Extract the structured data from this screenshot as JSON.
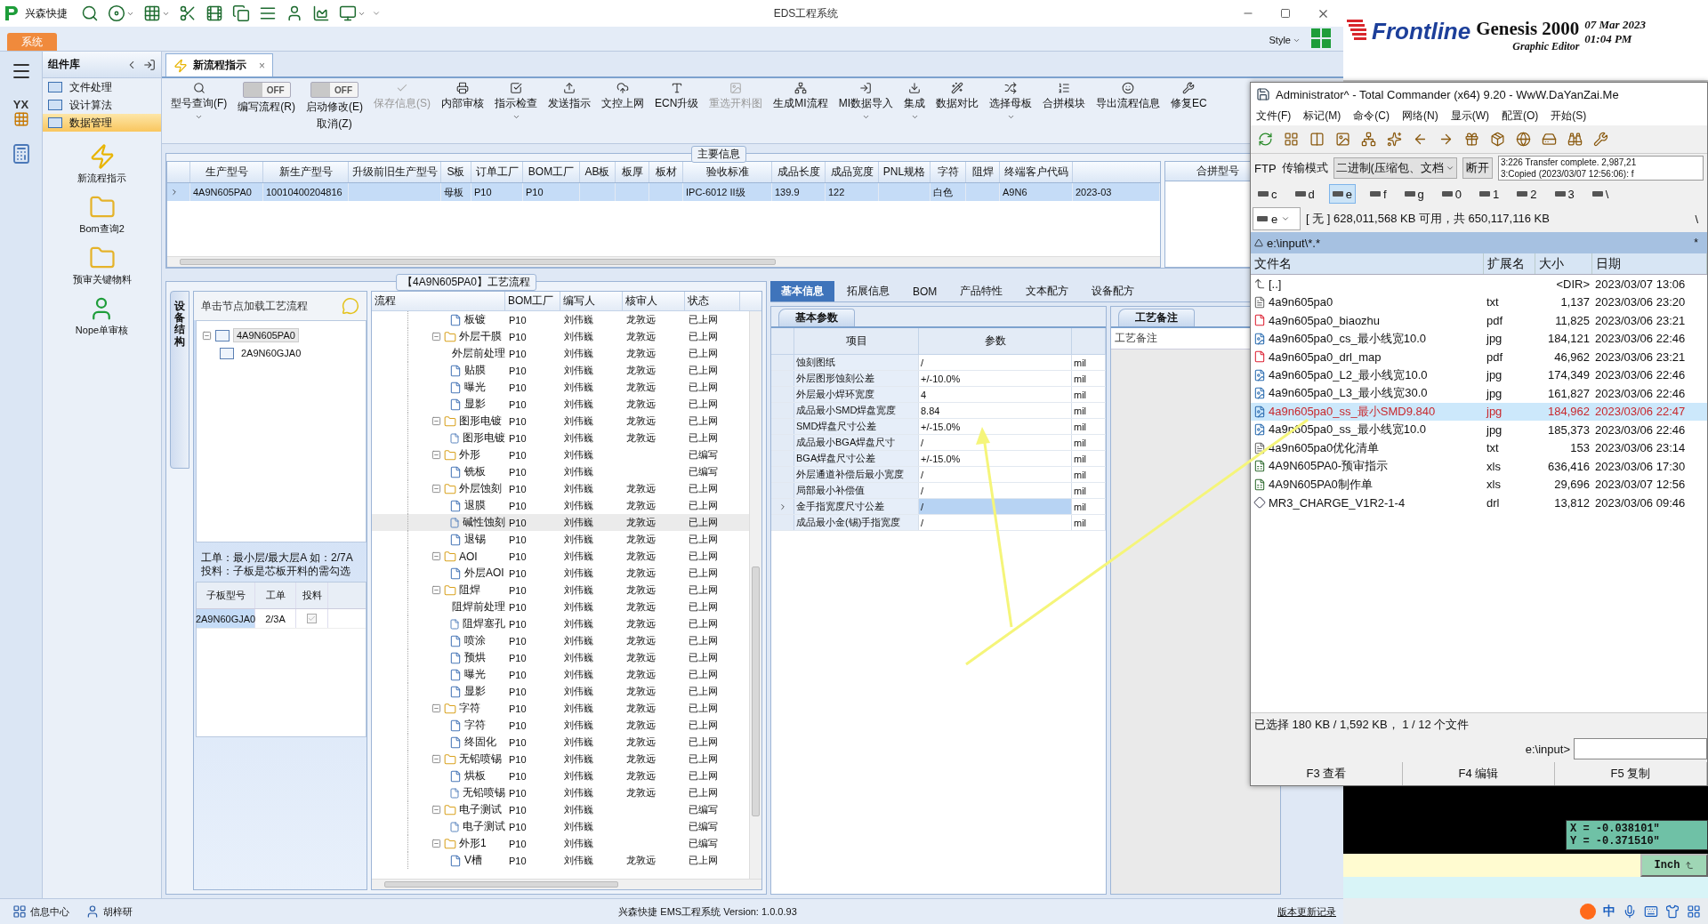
{
  "app": {
    "brand": "兴森快捷",
    "title": "EDS工程系统",
    "system_tab": "系统",
    "style_label": "Style",
    "logo_text": "YX"
  },
  "library": {
    "title": "组件库",
    "menu": [
      {
        "label": "文件处理",
        "selected": false
      },
      {
        "label": "设计算法",
        "selected": false
      },
      {
        "label": "数据管理",
        "selected": true
      }
    ],
    "launchers": [
      {
        "label": "新流程指示",
        "kind": "flash"
      },
      {
        "label": "Bom查询2",
        "kind": "folder"
      },
      {
        "label": "预审关键物料",
        "kind": "folder"
      },
      {
        "label": "Nope单审核",
        "kind": "user"
      }
    ]
  },
  "doc_tab": {
    "label": "新流程指示",
    "close": "×",
    "selected": true
  },
  "toolbar": [
    {
      "kind": "button",
      "label": "型号查询(F)",
      "menu": true,
      "disabled": false
    },
    {
      "kind": "toggle",
      "label": "编写流程(R)",
      "toggle": "OFF",
      "on": false
    },
    {
      "kind": "toggle",
      "label": "启动修改(E)",
      "sublabel": "取消(Z)",
      "toggle": "OFF",
      "on": false
    },
    {
      "kind": "button",
      "label": "保存信息(S)",
      "menu": false,
      "disabled": true
    },
    {
      "kind": "button",
      "label": "内部审核",
      "menu": false,
      "disabled": false
    },
    {
      "kind": "button",
      "label": "指示检查",
      "menu": true,
      "disabled": false
    },
    {
      "kind": "button",
      "label": "发送指示",
      "menu": false,
      "disabled": false
    },
    {
      "kind": "button",
      "label": "文控上网",
      "menu": false,
      "disabled": false
    },
    {
      "kind": "button",
      "label": "ECN升级",
      "menu": false,
      "disabled": false
    },
    {
      "kind": "button",
      "label": "重选开料图",
      "menu": false,
      "disabled": true
    },
    {
      "kind": "button",
      "label": "生成MI流程",
      "menu": false,
      "disabled": false
    },
    {
      "kind": "button",
      "label": "MI数据导入",
      "menu": true,
      "disabled": false
    },
    {
      "kind": "button",
      "label": "集成",
      "menu": true,
      "disabled": false
    },
    {
      "kind": "button",
      "label": "数据对比",
      "menu": false,
      "disabled": false
    },
    {
      "kind": "button",
      "label": "选择母板",
      "menu": true,
      "disabled": false
    },
    {
      "kind": "button",
      "label": "合拼模块",
      "menu": false,
      "disabled": false
    },
    {
      "kind": "button",
      "label": "导出流程信息",
      "menu": false,
      "disabled": false
    },
    {
      "kind": "button",
      "label": "修复EC",
      "menu": false,
      "disabled": false
    }
  ],
  "main_info": {
    "title": "主要信息",
    "columns": [
      "生产型号",
      "新生产型号",
      "升级前旧生产型号",
      "S板",
      "订单工厂",
      "BOM工厂",
      "AB板",
      "板厚",
      "板材",
      "验收标准",
      "成品长度",
      "成品宽度",
      "PNL规格",
      "字符",
      "阻焊",
      "终端客户代码"
    ],
    "rows": [
      {
        "selected": true,
        "cells": [
          "4A9N605PA0",
          "10010400204816",
          null,
          "母板",
          "P10",
          "P10",
          null,
          null,
          null,
          "IPC-6012 II级",
          "139.9",
          "122",
          null,
          "白色",
          null,
          "A9N6",
          "2023-03"
        ]
      }
    ],
    "side_header": "合拼型号"
  },
  "flow": {
    "title": "【4A9N605PA0】工艺流程",
    "side_tab": "设备结构",
    "hint": "单击节点加载工艺流程",
    "tree": [
      {
        "label": "4A9N605PA0",
        "selected": true,
        "expanded": true,
        "children": [
          {
            "label": "2A9N60GJA0",
            "selected": false
          }
        ]
      }
    ],
    "notes": [
      "工单：最小层/最大层A 如：2/7A",
      "投料：子板是芯板开料的需勾选"
    ],
    "sub_table": {
      "columns": [
        "子板型号",
        "工单",
        "投料"
      ],
      "rows": [
        {
          "cells": [
            "2A9N60GJA0",
            "2/3A"
          ],
          "checked": true,
          "selected": true
        }
      ]
    },
    "grid": {
      "columns": [
        "流程",
        "BOM工厂",
        "编写人",
        "核审人",
        "状态"
      ],
      "rows": [
        {
          "kind": "step",
          "label": "板镀",
          "bom": "P10",
          "author": "刘伟巍",
          "reviewer": "龙敦远",
          "status": "已上网",
          "selected": false
        },
        {
          "kind": "group",
          "label": "外层干膜",
          "bom": "P10",
          "author": "刘伟巍",
          "reviewer": "龙敦远",
          "status": "已上网",
          "selected": false,
          "expanded": true,
          "children": [
            {
              "kind": "step",
              "label": "外层前处理",
              "bom": "P10",
              "author": "刘伟巍",
              "reviewer": "龙敦远",
              "status": "已上网",
              "selected": false
            },
            {
              "kind": "step",
              "label": "贴膜",
              "bom": "P10",
              "author": "刘伟巍",
              "reviewer": "龙敦远",
              "status": "已上网",
              "selected": false
            },
            {
              "kind": "step",
              "label": "曝光",
              "bom": "P10",
              "author": "刘伟巍",
              "reviewer": "龙敦远",
              "status": "已上网",
              "selected": false
            },
            {
              "kind": "step",
              "label": "显影",
              "bom": "P10",
              "author": "刘伟巍",
              "reviewer": "龙敦远",
              "status": "已上网",
              "selected": false
            }
          ]
        },
        {
          "kind": "group",
          "label": "图形电镀",
          "bom": "P10",
          "author": "刘伟巍",
          "reviewer": "龙敦远",
          "status": "已上网",
          "selected": false,
          "expanded": true,
          "children": [
            {
              "kind": "step",
              "label": "图形电镀",
              "bom": "P10",
              "author": "刘伟巍",
              "reviewer": "龙敦远",
              "status": "已上网",
              "selected": false
            }
          ]
        },
        {
          "kind": "group",
          "label": "外形",
          "bom": "P10",
          "author": "刘伟巍",
          "status": "已编写",
          "selected": false,
          "expanded": true,
          "children": [
            {
              "kind": "step",
              "label": "铣板",
              "bom": "P10",
              "author": "刘伟巍",
              "status": "已编写",
              "selected": false
            }
          ]
        },
        {
          "kind": "group",
          "label": "外层蚀刻",
          "bom": "P10",
          "author": "刘伟巍",
          "reviewer": "龙敦远",
          "status": "已上网",
          "selected": false,
          "expanded": true,
          "children": [
            {
              "kind": "step",
              "label": "退膜",
              "bom": "P10",
              "author": "刘伟巍",
              "reviewer": "龙敦远",
              "status": "已上网",
              "selected": false
            },
            {
              "kind": "step",
              "label": "碱性蚀刻",
              "bom": "P10",
              "author": "刘伟巍",
              "reviewer": "龙敦远",
              "status": "已上网",
              "selected": true
            },
            {
              "kind": "step",
              "label": "退锡",
              "bom": "P10",
              "author": "刘伟巍",
              "reviewer": "龙敦远",
              "status": "已上网",
              "selected": false
            }
          ]
        },
        {
          "kind": "group",
          "label": "AOI",
          "bom": "P10",
          "author": "刘伟巍",
          "reviewer": "龙敦远",
          "status": "已上网",
          "selected": false,
          "expanded": true,
          "children": [
            {
              "kind": "step",
              "label": "外层AOI",
              "bom": "P10",
              "author": "刘伟巍",
              "reviewer": "龙敦远",
              "status": "已上网",
              "selected": false
            }
          ]
        },
        {
          "kind": "group",
          "label": "阻焊",
          "bom": "P10",
          "author": "刘伟巍",
          "reviewer": "龙敦远",
          "status": "已上网",
          "selected": false,
          "expanded": true,
          "children": [
            {
              "kind": "step",
              "label": "阻焊前处理",
              "bom": "P10",
              "author": "刘伟巍",
              "reviewer": "龙敦远",
              "status": "已上网",
              "selected": false
            },
            {
              "kind": "step",
              "label": "阻焊塞孔",
              "bom": "P10",
              "author": "刘伟巍",
              "reviewer": "龙敦远",
              "status": "已上网",
              "selected": false
            },
            {
              "kind": "step",
              "label": "喷涂",
              "bom": "P10",
              "author": "刘伟巍",
              "reviewer": "龙敦远",
              "status": "已上网",
              "selected": false
            },
            {
              "kind": "step",
              "label": "预烘",
              "bom": "P10",
              "author": "刘伟巍",
              "reviewer": "龙敦远",
              "status": "已上网",
              "selected": false
            },
            {
              "kind": "step",
              "label": "曝光",
              "bom": "P10",
              "author": "刘伟巍",
              "reviewer": "龙敦远",
              "status": "已上网",
              "selected": false
            },
            {
              "kind": "step",
              "label": "显影",
              "bom": "P10",
              "author": "刘伟巍",
              "reviewer": "龙敦远",
              "status": "已上网",
              "selected": false
            }
          ]
        },
        {
          "kind": "group",
          "label": "字符",
          "bom": "P10",
          "author": "刘伟巍",
          "reviewer": "龙敦远",
          "status": "已上网",
          "selected": false,
          "expanded": true,
          "children": [
            {
              "kind": "step",
              "label": "字符",
              "bom": "P10",
              "author": "刘伟巍",
              "reviewer": "龙敦远",
              "status": "已上网",
              "selected": false
            },
            {
              "kind": "step",
              "label": "终固化",
              "bom": "P10",
              "author": "刘伟巍",
              "reviewer": "龙敦远",
              "status": "已上网",
              "selected": false
            }
          ]
        },
        {
          "kind": "group",
          "label": "无铅喷锡",
          "bom": "P10",
          "author": "刘伟巍",
          "reviewer": "龙敦远",
          "status": "已上网",
          "selected": false,
          "expanded": true,
          "children": [
            {
              "kind": "step",
              "label": "烘板",
              "bom": "P10",
              "author": "刘伟巍",
              "reviewer": "龙敦远",
              "status": "已上网",
              "selected": false
            },
            {
              "kind": "step",
              "label": "无铅喷锡",
              "bom": "P10",
              "author": "刘伟巍",
              "reviewer": "龙敦远",
              "status": "已上网",
              "selected": false
            }
          ]
        },
        {
          "kind": "group",
          "label": "电子测试",
          "bom": "P10",
          "author": "刘伟巍",
          "status": "已编写",
          "selected": false,
          "expanded": true,
          "children": [
            {
              "kind": "step",
              "label": "电子测试",
              "bom": "P10",
              "author": "刘伟巍",
              "status": "已编写",
              "selected": false
            }
          ]
        },
        {
          "kind": "group",
          "label": "外形1",
          "bom": "P10",
          "author": "刘伟巍",
          "status": "已编写",
          "selected": false,
          "expanded": true,
          "children": [
            {
              "kind": "step",
              "label": "V槽",
              "bom": "P10",
              "author": "刘伟巍",
              "reviewer": "龙敦远",
              "status": "已上网",
              "selected": false
            }
          ]
        }
      ]
    }
  },
  "details": {
    "tabs": [
      {
        "label": "基本信息",
        "selected": true
      },
      {
        "label": "拓展信息",
        "selected": false
      },
      {
        "label": "BOM",
        "selected": false
      },
      {
        "label": "产品特性",
        "selected": false
      },
      {
        "label": "文本配方",
        "selected": false
      },
      {
        "label": "设备配方",
        "selected": false
      }
    ],
    "sub_tab": "基本参数",
    "columns": [
      "项目",
      "参数"
    ],
    "rows": [
      {
        "item": "蚀刻图纸",
        "value": "/",
        "unit": "mil",
        "selected": false
      },
      {
        "item": "外层图形蚀刻公差",
        "value": "+/-10.0%",
        "unit": "mil",
        "selected": false
      },
      {
        "item": "外层最小焊环宽度",
        "value": "4",
        "unit": "mil",
        "selected": false
      },
      {
        "item": "成品最小SMD焊盘宽度",
        "value": "8.84",
        "unit": "mil",
        "selected": false
      },
      {
        "item": "SMD焊盘尺寸公差",
        "value": "+/-15.0%",
        "unit": "mil",
        "selected": false
      },
      {
        "item": "成品最小BGA焊盘尺寸",
        "value": "/",
        "unit": "mil",
        "selected": false
      },
      {
        "item": "BGA焊盘尺寸公差",
        "value": "+/-15.0%",
        "unit": "mil",
        "selected": false
      },
      {
        "item": "外层通道补偿后最小宽度",
        "value": "/",
        "unit": "mil",
        "selected": false
      },
      {
        "item": "局部最小补偿值",
        "value": "/",
        "unit": "mil",
        "selected": false
      },
      {
        "item": "金手指宽度尺寸公差",
        "value": "/",
        "unit": "mil",
        "selected": true
      },
      {
        "item": "成品最小金(锡)手指宽度",
        "value": "/",
        "unit": "mil",
        "selected": false
      }
    ],
    "notes_tab": "工艺备注",
    "notes_header": "工艺备注"
  },
  "status_bar": {
    "items": [
      {
        "label": "信息中心",
        "kind": "grid"
      },
      {
        "label": "胡梓研",
        "kind": "user"
      }
    ],
    "center": "兴森快捷 EMS工程系统 Version: 1.0.0.93",
    "link": "版本更新记录"
  },
  "commander": {
    "title": "Administrator^ - Total Commander (x64) 9.20 - WwW.DaYanZai.Me",
    "menu": [
      "文件(F)",
      "标记(M)",
      "命令(C)",
      "网络(N)",
      "显示(W)",
      "配置(O)",
      "开始(S)"
    ],
    "ftp": {
      "label": "FTP",
      "mode_label": "传输模式",
      "mode": "二进制(压缩包、文档",
      "disconnect": "断开",
      "log": [
        "3:226 Transfer complete. 2,987,21",
        "3:Copied (2023/03/07 12:56:06): f"
      ]
    },
    "drives": [
      {
        "label": "c",
        "selected": false
      },
      {
        "label": "d",
        "selected": false
      },
      {
        "label": "e",
        "selected": true
      },
      {
        "label": "f",
        "selected": false
      },
      {
        "label": "g",
        "selected": false
      },
      {
        "label": "0",
        "selected": false
      },
      {
        "label": "1",
        "selected": false
      },
      {
        "label": "2",
        "selected": false
      },
      {
        "label": "3",
        "selected": false
      },
      {
        "label": "\\",
        "selected": false
      }
    ],
    "drive": "e",
    "space": "[ 无 ]  628,011,568 KB 可用，共 650,117,116 KB",
    "root": "\\",
    "path": "e:\\input\\*.*",
    "filter": "*",
    "columns": [
      "文件名",
      "扩展名",
      "大小",
      "日期"
    ],
    "files": [
      {
        "name": "[..]",
        "size": "<DIR>",
        "date": "2023/03/07 13:06",
        "kind": "up",
        "selected": false
      },
      {
        "name": "4a9n605pa0",
        "ext": "txt",
        "size": "1,137",
        "date": "2023/03/06 23:20",
        "kind": "text",
        "selected": false
      },
      {
        "name": "4a9n605pa0_biaozhu",
        "ext": "pdf",
        "size": "11,825",
        "date": "2023/03/06 23:21",
        "kind": "pdf",
        "selected": false
      },
      {
        "name": "4a9n605pa0_cs_最小线宽10.0",
        "ext": "jpg",
        "size": "184,121",
        "date": "2023/03/06 22:46",
        "kind": "image",
        "selected": false
      },
      {
        "name": "4a9n605pa0_drl_map",
        "ext": "pdf",
        "size": "46,962",
        "date": "2023/03/06 23:21",
        "kind": "pdf",
        "selected": false
      },
      {
        "name": "4a9n605pa0_L2_最小线宽10.0",
        "ext": "jpg",
        "size": "174,349",
        "date": "2023/03/06 22:46",
        "kind": "image",
        "selected": false
      },
      {
        "name": "4a9n605pa0_L3_最小线宽30.0",
        "ext": "jpg",
        "size": "161,827",
        "date": "2023/03/06 22:46",
        "kind": "image",
        "selected": false
      },
      {
        "name": "4a9n605pa0_ss_最小SMD9.840",
        "ext": "jpg",
        "size": "184,962",
        "date": "2023/03/06 22:47",
        "kind": "image",
        "selected": true
      },
      {
        "name": "4a9n605pa0_ss_最小线宽10.0",
        "ext": "jpg",
        "size": "185,373",
        "date": "2023/03/06 22:46",
        "kind": "image",
        "selected": false
      },
      {
        "name": "4a9n605pa0优化清单",
        "ext": "txt",
        "size": "153",
        "date": "2023/03/06 23:14",
        "kind": "text",
        "selected": false
      },
      {
        "name": "4A9N605PA0-预审指示",
        "ext": "xls",
        "size": "636,416",
        "date": "2023/03/06 17:30",
        "kind": "sheet",
        "selected": false
      },
      {
        "name": "4A9N605PA0制作单",
        "ext": "xls",
        "size": "29,696",
        "date": "2023/03/07 12:56",
        "kind": "sheet",
        "selected": false
      },
      {
        "name": "MR3_CHARGE_V1R2-1-4",
        "ext": "drl",
        "size": "13,812",
        "date": "2023/03/06 09:46",
        "kind": "drill",
        "selected": false
      }
    ],
    "status": "已选择 180 KB / 1,592 KB， 1 / 12 个文件",
    "prompt": "e:\\input>",
    "fkeys": [
      "F3 查看",
      "F4 编辑",
      "F5 复制"
    ]
  },
  "genesis": {
    "brand": "Frontline",
    "product": "Genesis 2000",
    "subtitle": "Graphic Editor",
    "date": "07 Mar 2023",
    "time": "01:04 PM",
    "x": "X = -0.038101\"",
    "y": "Y = -0.371510\"",
    "units": "Inch",
    "ime": "中"
  }
}
